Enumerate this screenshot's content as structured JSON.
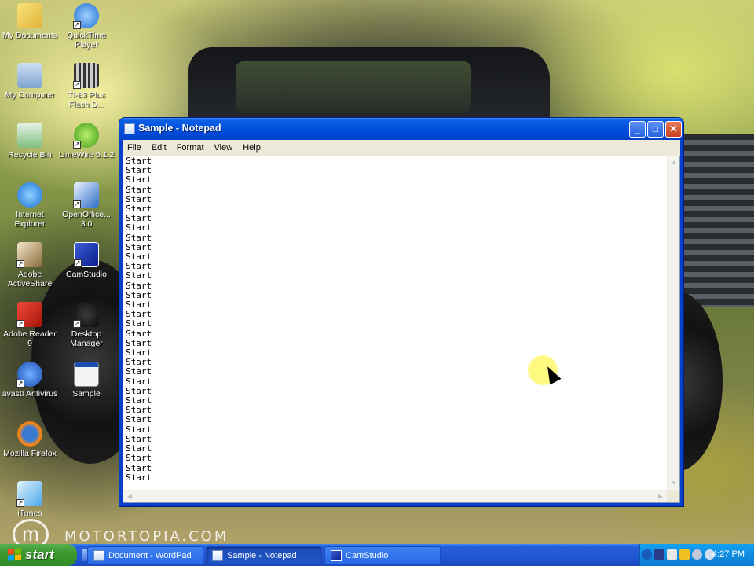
{
  "desktop": {
    "watermark": "MOTORTOPIA.COM",
    "watermark_logo": "m",
    "icons": [
      {
        "label": "My Documents",
        "icon": "my-documents-icon"
      },
      {
        "label": "QuickTime Player",
        "icon": "quicktime-icon"
      },
      {
        "label": "My Computer",
        "icon": "my-computer-icon"
      },
      {
        "label": "TI-83 Plus Flash D...",
        "icon": "ti83-icon"
      },
      {
        "label": "Recycle Bin",
        "icon": "recycle-bin-icon"
      },
      {
        "label": "LimeWire 5.1.2",
        "icon": "limewire-icon"
      },
      {
        "label": "Internet Explorer",
        "icon": "internet-explorer-icon"
      },
      {
        "label": "OpenOffice... 3.0",
        "icon": "openoffice-icon"
      },
      {
        "label": "Adobe ActiveShare",
        "icon": "adobe-activeshare-icon"
      },
      {
        "label": "CamStudio",
        "icon": "camstudio-icon"
      },
      {
        "label": "Adobe Reader 9",
        "icon": "adobe-reader-icon"
      },
      {
        "label": "Desktop Manager",
        "icon": "desktop-manager-icon"
      },
      {
        "label": "avast! Antivirus",
        "icon": "avast-icon"
      },
      {
        "label": "Sample",
        "icon": "sample-batch-icon"
      },
      {
        "label": "Mozilla Firefox",
        "icon": "firefox-icon"
      },
      {
        "label": "iTunes",
        "icon": "itunes-icon"
      }
    ]
  },
  "notepad": {
    "title": "Sample - Notepad",
    "minimize_label": "_",
    "maximize_label": "□",
    "close_label": "✕",
    "menu": [
      "File",
      "Edit",
      "Format",
      "View",
      "Help"
    ],
    "content_lines": [
      "Start",
      "Start",
      "Start",
      "Start",
      "Start",
      "Start",
      "Start",
      "Start",
      "Start",
      "Start",
      "Start",
      "Start",
      "Start",
      "Start",
      "Start",
      "Start",
      "Start",
      "Start",
      "Start",
      "Start",
      "Start",
      "Start",
      "Start",
      "Start",
      "Start",
      "Start",
      "Start",
      "Start",
      "Start",
      "Start",
      "Start",
      "Start",
      "Start",
      "Start"
    ]
  },
  "taskbar": {
    "start_label": "start",
    "tasks": [
      {
        "label": "Document - WordPad",
        "active": false
      },
      {
        "label": "Sample - Notepad",
        "active": true
      },
      {
        "label": "CamStudio",
        "active": false
      }
    ],
    "clock": "4:27 PM"
  },
  "colors": {
    "titlebar": "#0050de",
    "taskbar": "#245edb",
    "start_button": "#3c9a30",
    "tray": "#0f8be0",
    "cursor_highlight": "#ffff80"
  }
}
